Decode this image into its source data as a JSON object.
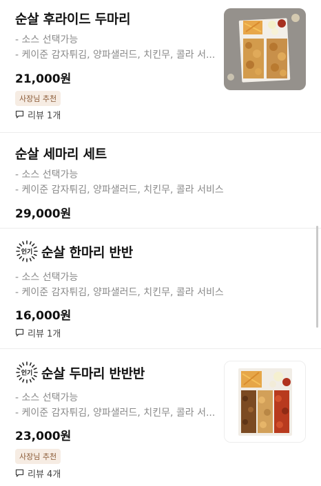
{
  "items": [
    {
      "title": "순살 후라이드 두마리",
      "desc1": "- 소스 선택가능",
      "desc2": "- 케이준 감자튀김, 양파샐러드, 치킨무, 콜라 서...",
      "price": "21,000원",
      "badge": "사장님 추천",
      "review": "리뷰 1개"
    },
    {
      "title": "순살 세마리 세트",
      "desc1": "- 소스 선택가능",
      "desc2": "- 케이준 감자튀김, 양파샐러드, 치킨무, 콜라 서비스",
      "price": "29,000원"
    },
    {
      "popular": "인기",
      "title": "순살 한마리 반반",
      "desc1": "- 소스 선택가능",
      "desc2": "- 케이준 감자튀김, 양파샐러드, 치킨무, 콜라 서비스",
      "price": "16,000원",
      "review": "리뷰 1개"
    },
    {
      "popular": "인기",
      "title": "순살 두마리 반반반",
      "desc1": "- 소스 선택가능",
      "desc2": "- 케이준 감자튀김, 양파샐러드, 치킨무, 콜라 서...",
      "price": "23,000원",
      "badge": "사장님 추천",
      "review": "리뷰 4개"
    }
  ],
  "colors": {
    "badge_bg": "#f6ece3",
    "badge_text": "#8a5a36",
    "price": "#111111",
    "desc": "#8a8a8a"
  },
  "icons": {
    "review": "speech-bubble-icon",
    "popular": "popular-burst-icon"
  }
}
